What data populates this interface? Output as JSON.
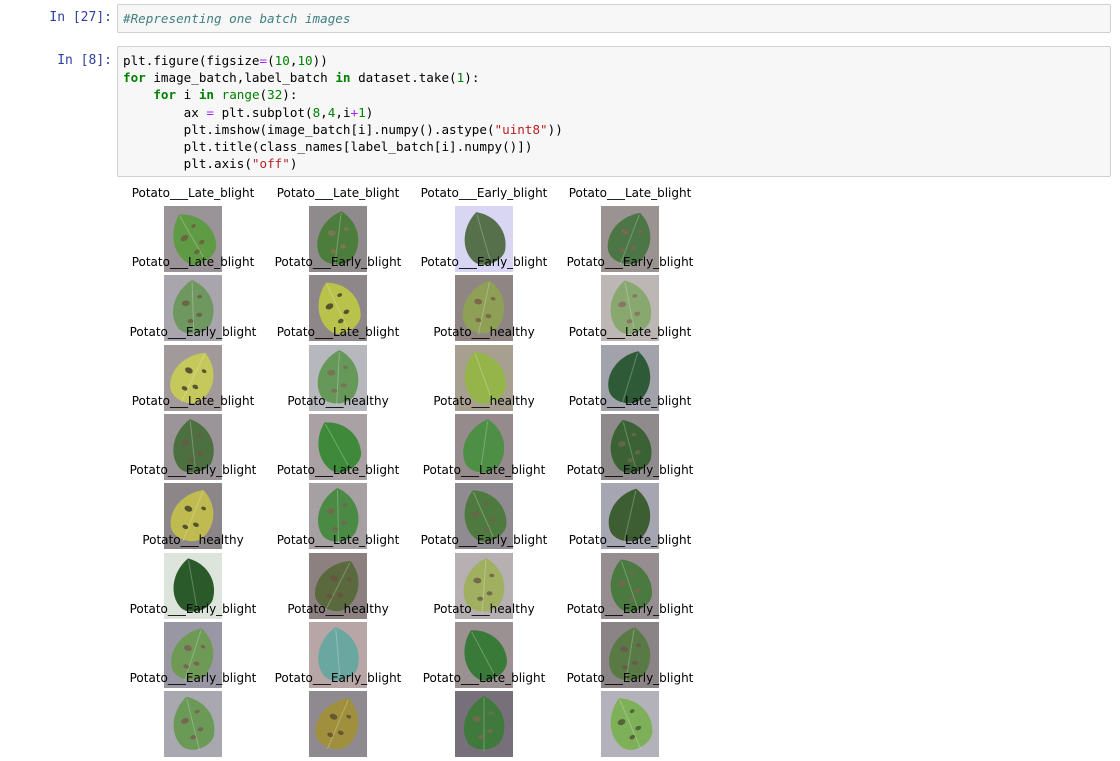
{
  "cells": [
    {
      "prompt": "In [27]:",
      "lines": [
        [
          {
            "t": "#Representing one batch images",
            "c": "cm"
          }
        ]
      ]
    },
    {
      "prompt": "In [8]:",
      "lines": [
        [
          {
            "t": "plt.figure(figsize"
          },
          {
            "t": "=",
            "c": "op"
          },
          {
            "t": "("
          },
          {
            "t": "10",
            "c": "num"
          },
          {
            "t": ","
          },
          {
            "t": "10",
            "c": "num"
          },
          {
            "t": "))"
          }
        ],
        [
          {
            "t": "for",
            "c": "kw"
          },
          {
            "t": " image_batch,label_batch "
          },
          {
            "t": "in",
            "c": "kw"
          },
          {
            "t": " dataset.take("
          },
          {
            "t": "1",
            "c": "num"
          },
          {
            "t": "):"
          }
        ],
        [
          {
            "t": "    "
          },
          {
            "t": "for",
            "c": "kw"
          },
          {
            "t": " i "
          },
          {
            "t": "in",
            "c": "kw"
          },
          {
            "t": " "
          },
          {
            "t": "range",
            "c": "bi"
          },
          {
            "t": "("
          },
          {
            "t": "32",
            "c": "num"
          },
          {
            "t": "):"
          }
        ],
        [
          {
            "t": "        ax "
          },
          {
            "t": "=",
            "c": "op"
          },
          {
            "t": " plt.subplot("
          },
          {
            "t": "8",
            "c": "num"
          },
          {
            "t": ","
          },
          {
            "t": "4",
            "c": "num"
          },
          {
            "t": ",i"
          },
          {
            "t": "+",
            "c": "op"
          },
          {
            "t": "1",
            "c": "num"
          },
          {
            "t": ")"
          }
        ],
        [
          {
            "t": "        plt.imshow(image_batch[i].numpy().astype("
          },
          {
            "t": "\"uint8\"",
            "c": "str"
          },
          {
            "t": "))"
          }
        ],
        [
          {
            "t": "        plt.title(class_names[label_batch[i].numpy()])"
          }
        ],
        [
          {
            "t": "        plt.axis("
          },
          {
            "t": "\"off\"",
            "c": "str"
          },
          {
            "t": ")"
          }
        ]
      ]
    }
  ],
  "figure": {
    "rows": 8,
    "cols": 4,
    "images": [
      {
        "title": "Potato___Late_blight",
        "bg": "#9a9498",
        "leaf": "#5f9a45",
        "spot": "#6e5a3a"
      },
      {
        "title": "Potato___Late_blight",
        "bg": "#8f8a8c",
        "leaf": "#4d7d3c",
        "spot": "#8a7455"
      },
      {
        "title": "Potato___Early_blight",
        "bg": "#d8d6f2",
        "leaf": "#55704a",
        "spot": "#55704a"
      },
      {
        "title": "Potato___Late_blight",
        "bg": "#9b9292",
        "leaf": "#4c7645",
        "spot": "#7a6850"
      },
      {
        "title": "Potato___Late_blight",
        "bg": "#a8a5ad",
        "leaf": "#6f9860",
        "spot": "#6b5a44"
      },
      {
        "title": "Potato___Early_blight",
        "bg": "#8d8789",
        "leaf": "#b9c24a",
        "spot": "#3a3a22"
      },
      {
        "title": "Potato___Early_blight",
        "bg": "#8f8582",
        "leaf": "#8ea055",
        "spot": "#7a5a48"
      },
      {
        "title": "Potato___Early_blight",
        "bg": "#bcb6b4",
        "leaf": "#88a870",
        "spot": "#8a6a60"
      },
      {
        "title": "Potato___Early_blight",
        "bg": "#a29a9a",
        "leaf": "#c5c85a",
        "spot": "#3c3a28"
      },
      {
        "title": "Potato___Late_blight",
        "bg": "#b6b8bd",
        "leaf": "#66985a",
        "spot": "#7b6a55"
      },
      {
        "title": "Potato___healthy",
        "bg": "#a7a090",
        "leaf": "#95b54a",
        "spot": "#95b54a"
      },
      {
        "title": "Potato___Late_blight",
        "bg": "#a2a2ab",
        "leaf": "#2f5a38",
        "spot": "#2f5a38"
      },
      {
        "title": "Potato___Late_blight",
        "bg": "#9b9599",
        "leaf": "#4d7040",
        "spot": "#6b5848"
      },
      {
        "title": "Potato___healthy",
        "bg": "#a9a1a4",
        "leaf": "#3f8a3a",
        "spot": "#3f8a3a"
      },
      {
        "title": "Potato___healthy",
        "bg": "#958a8c",
        "leaf": "#4c8f45",
        "spot": "#4c8f45"
      },
      {
        "title": "Potato___Late_blight",
        "bg": "#8f8b8d",
        "leaf": "#3a6234",
        "spot": "#6b6a50"
      },
      {
        "title": "Potato___Early_blight",
        "bg": "#8d8688",
        "leaf": "#bfbb50",
        "spot": "#3a3a25"
      },
      {
        "title": "Potato___Late_blight",
        "bg": "#a7a0a3",
        "leaf": "#4a8a45",
        "spot": "#7a5f50"
      },
      {
        "title": "Potato___Late_blight",
        "bg": "#8f8b90",
        "leaf": "#4f7a3f",
        "spot": "#6e6248"
      },
      {
        "title": "Potato___Early_blight",
        "bg": "#a6a6b2",
        "leaf": "#3d5e32",
        "spot": "#3d5e32"
      },
      {
        "title": "Potato___healthy",
        "bg": "#dde4dc",
        "leaf": "#2b5a2a",
        "spot": "#2b5a2a"
      },
      {
        "title": "Potato___Late_blight",
        "bg": "#8c8080",
        "leaf": "#5a6a3e",
        "spot": "#6a5040"
      },
      {
        "title": "Potato___Early_blight",
        "bg": "#b6b0b2",
        "leaf": "#a0b060",
        "spot": "#6a5a44"
      },
      {
        "title": "Potato___Late_blight",
        "bg": "#958d8f",
        "leaf": "#4a7a40",
        "spot": "#7a6550"
      },
      {
        "title": "Potato___Early_blight",
        "bg": "#9a97a4",
        "leaf": "#6e9a55",
        "spot": "#7a5a5a"
      },
      {
        "title": "Potato___healthy",
        "bg": "#b8a5a6",
        "leaf": "#6aa7a0",
        "spot": "#6aa7a0"
      },
      {
        "title": "Potato___healthy",
        "bg": "#9b9092",
        "leaf": "#3a7a38",
        "spot": "#3a7a38"
      },
      {
        "title": "Potato___Early_blight",
        "bg": "#8a8486",
        "leaf": "#5a7a45",
        "spot": "#6a5550"
      },
      {
        "title": "Potato___Early_blight",
        "bg": "#a9a7b0",
        "leaf": "#6a9a55",
        "spot": "#7a5a5a"
      },
      {
        "title": "Potato___Early_blight",
        "bg": "#8f8a8f",
        "leaf": "#a0903e",
        "spot": "#5a4a2e"
      },
      {
        "title": "Potato___Late_blight",
        "bg": "#77707a",
        "leaf": "#3f7a3c",
        "spot": "#7a6a50"
      },
      {
        "title": "Potato___Early_blight",
        "bg": "#b3b2ba",
        "leaf": "#7eb05a",
        "spot": "#4a5030"
      }
    ]
  }
}
